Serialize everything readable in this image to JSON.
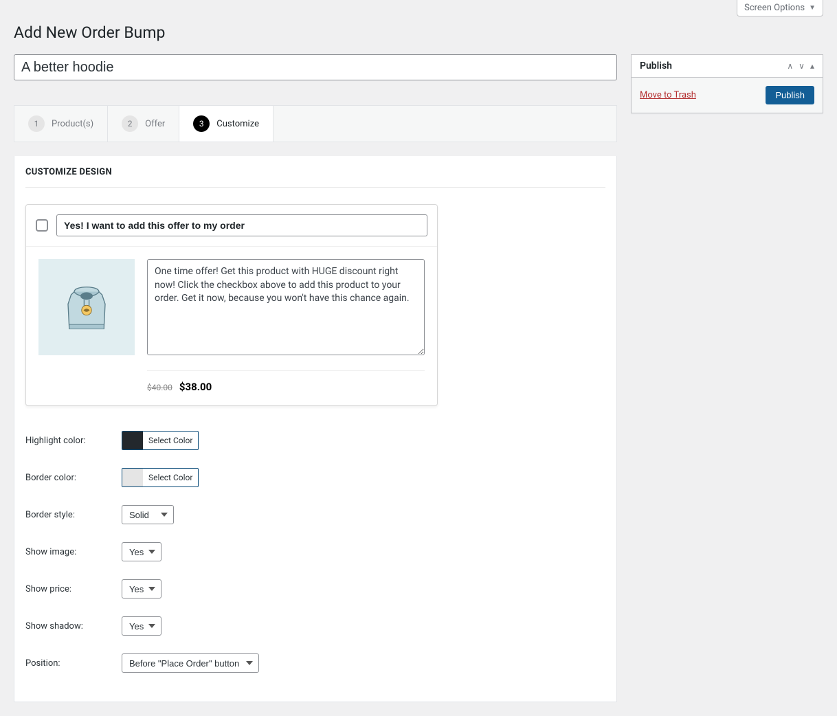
{
  "screen_options": "Screen Options",
  "page_title": "Add New Order Bump",
  "title_value": "A better hoodie",
  "steps": [
    {
      "num": "1",
      "label": "Product(s)"
    },
    {
      "num": "2",
      "label": "Offer"
    },
    {
      "num": "3",
      "label": "Customize"
    }
  ],
  "panel_title": "CUSTOMIZE DESIGN",
  "preview": {
    "headline": "Yes! I want to add this offer to my order",
    "description": "One time offer! Get this product with HUGE discount right now! Click the checkbox above to add this product to your order. Get it now, because you won't have this chance again.",
    "old_price": "$40.00",
    "new_price": "$38.00"
  },
  "fields": {
    "highlight_label": "Highlight color:",
    "highlight_swatch": "#23282d",
    "border_label": "Border color:",
    "border_swatch": "#e5e5e5",
    "select_color_text": "Select Color",
    "border_style_label": "Border style:",
    "border_style_value": "Solid",
    "show_image_label": "Show image:",
    "show_image_value": "Yes",
    "show_price_label": "Show price:",
    "show_price_value": "Yes",
    "show_shadow_label": "Show shadow:",
    "show_shadow_value": "Yes",
    "position_label": "Position:",
    "position_value": "Before \"Place Order\" button"
  },
  "sidebar": {
    "publish_title": "Publish",
    "trash": "Move to Trash",
    "publish_btn": "Publish"
  }
}
